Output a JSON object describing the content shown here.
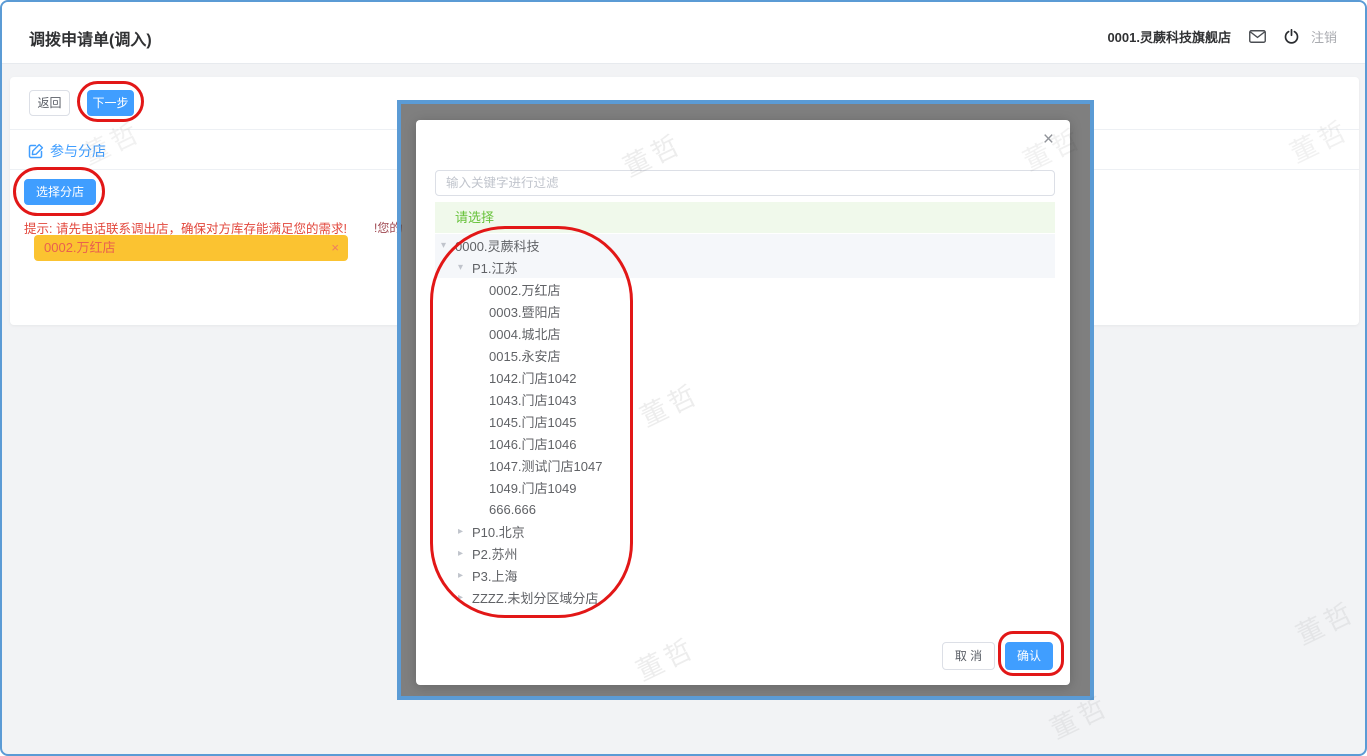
{
  "header": {
    "title": "调拨申请单(调入)",
    "shop": "0001.灵蕨科技旗舰店",
    "logout": "注销"
  },
  "toolbar": {
    "back": "返回",
    "next": "下一步"
  },
  "section": {
    "title": "参与分店",
    "select_store": "选择分店",
    "hint": "提示: 请先电话联系调出店，确保对方库存能满足您的需求!",
    "selected_tag": "0002.万红店",
    "tag_close": "×",
    "bg_fragment": "!您的"
  },
  "dialog": {
    "close": "×",
    "filter_placeholder": "输入关键字进行过滤",
    "banner": "请选择",
    "caret_down_glyph": "▾",
    "caret_right_glyph": "▸",
    "tree": [
      {
        "label": "0000.灵蕨科技",
        "level": 1,
        "caret": "down",
        "highlight": true
      },
      {
        "label": "P1.江苏",
        "level": 2,
        "caret": "down",
        "highlight": true
      },
      {
        "label": "0002.万红店",
        "level": 3,
        "caret": "none",
        "highlight": false
      },
      {
        "label": "0003.暨阳店",
        "level": 3,
        "caret": "none",
        "highlight": false
      },
      {
        "label": "0004.城北店",
        "level": 3,
        "caret": "none",
        "highlight": false
      },
      {
        "label": "0015.永安店",
        "level": 3,
        "caret": "none",
        "highlight": false
      },
      {
        "label": "1042.门店1042",
        "level": 3,
        "caret": "none",
        "highlight": false
      },
      {
        "label": "1043.门店1043",
        "level": 3,
        "caret": "none",
        "highlight": false
      },
      {
        "label": "1045.门店1045",
        "level": 3,
        "caret": "none",
        "highlight": false
      },
      {
        "label": "1046.门店1046",
        "level": 3,
        "caret": "none",
        "highlight": false
      },
      {
        "label": "1047.测试门店1047",
        "level": 3,
        "caret": "none",
        "highlight": false
      },
      {
        "label": "1049.门店1049",
        "level": 3,
        "caret": "none",
        "highlight": false
      },
      {
        "label": "666.666",
        "level": 3,
        "caret": "none",
        "highlight": false
      },
      {
        "label": "P10.北京",
        "level": 2,
        "caret": "right",
        "highlight": false
      },
      {
        "label": "P2.苏州",
        "level": 2,
        "caret": "right",
        "highlight": false
      },
      {
        "label": "P3.上海",
        "level": 2,
        "caret": "right",
        "highlight": false
      },
      {
        "label": "ZZZZ.未划分区域分店",
        "level": 2,
        "caret": "right",
        "highlight": false
      }
    ],
    "cancel": "取 消",
    "confirm": "确认"
  },
  "watermark": {
    "text": "董哲"
  },
  "colors": {
    "accent": "#409EFF",
    "annotation": "#E21717",
    "page_border": "#5B9BD5",
    "hint_red": "#E2473C",
    "tag_bg": "#FBC331",
    "tag_text": "#E9604F",
    "banner_bg": "#F0F9EB",
    "banner_text": "#67C23A",
    "tree_highlight": "#F5F7FA"
  }
}
